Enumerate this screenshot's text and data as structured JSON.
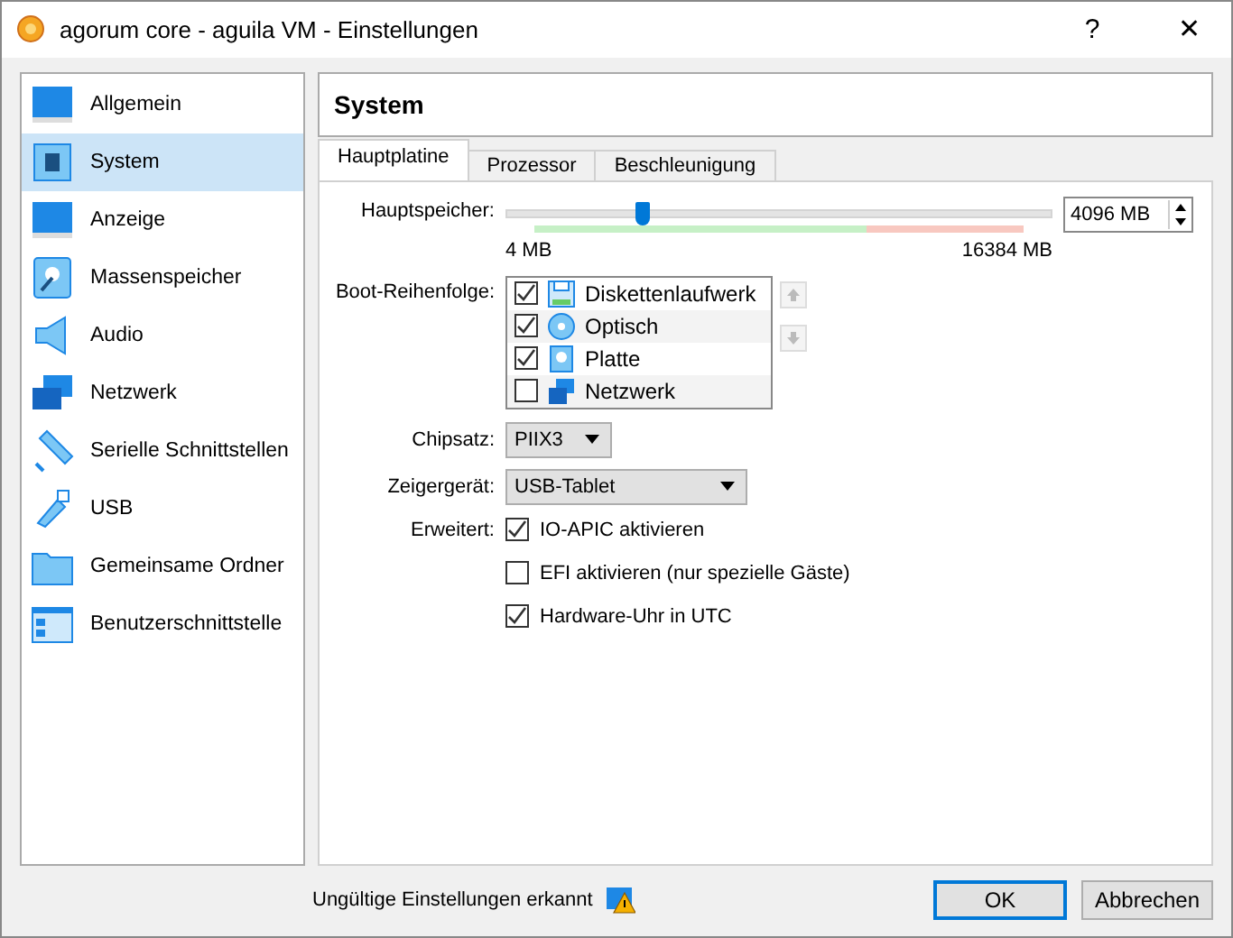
{
  "window": {
    "title": "agorum core - aguila VM - Einstellungen",
    "help": "?",
    "close": "✕"
  },
  "sidebar": {
    "items": [
      {
        "label": "Allgemein",
        "selected": false
      },
      {
        "label": "System",
        "selected": true
      },
      {
        "label": "Anzeige",
        "selected": false
      },
      {
        "label": "Massenspeicher",
        "selected": false
      },
      {
        "label": "Audio",
        "selected": false
      },
      {
        "label": "Netzwerk",
        "selected": false
      },
      {
        "label": "Serielle Schnittstellen",
        "selected": false
      },
      {
        "label": "USB",
        "selected": false
      },
      {
        "label": "Gemeinsame Ordner",
        "selected": false
      },
      {
        "label": "Benutzerschnittstelle",
        "selected": false
      }
    ]
  },
  "header": "System",
  "tabs": [
    {
      "label": "Hauptplatine",
      "selected": true
    },
    {
      "label": "Prozessor",
      "selected": false
    },
    {
      "label": "Beschleunigung",
      "selected": false
    }
  ],
  "memory": {
    "label": "Hauptspeicher:",
    "level": 0.25,
    "value": "4096 MB",
    "min": "4 MB",
    "max": "16384 MB"
  },
  "boot_order": {
    "label": "Boot-Reihenfolge:",
    "items": [
      {
        "label": "Diskettenlaufwerk",
        "checked": true
      },
      {
        "label": "Optisch",
        "checked": true
      },
      {
        "label": "Platte",
        "checked": true
      },
      {
        "label": "Netzwerk",
        "checked": false
      }
    ]
  },
  "chipset": {
    "label": "Chipsatz:",
    "value": "PIIX3"
  },
  "pointing_device": {
    "label": "Zeigergerät:",
    "value": "USB-Tablet"
  },
  "extended": {
    "label": "Erweitert:",
    "options": [
      {
        "label": "IO-APIC aktivieren",
        "checked": true
      },
      {
        "label": "EFI aktivieren (nur spezielle Gäste)",
        "checked": false
      },
      {
        "label": "Hardware-Uhr in UTC",
        "checked": true
      }
    ]
  },
  "status": "Ungültige Einstellungen erkannt",
  "buttons": [
    {
      "label": "OK",
      "kind": "default"
    },
    {
      "label": "Abbrechen",
      "kind": "normal"
    }
  ]
}
